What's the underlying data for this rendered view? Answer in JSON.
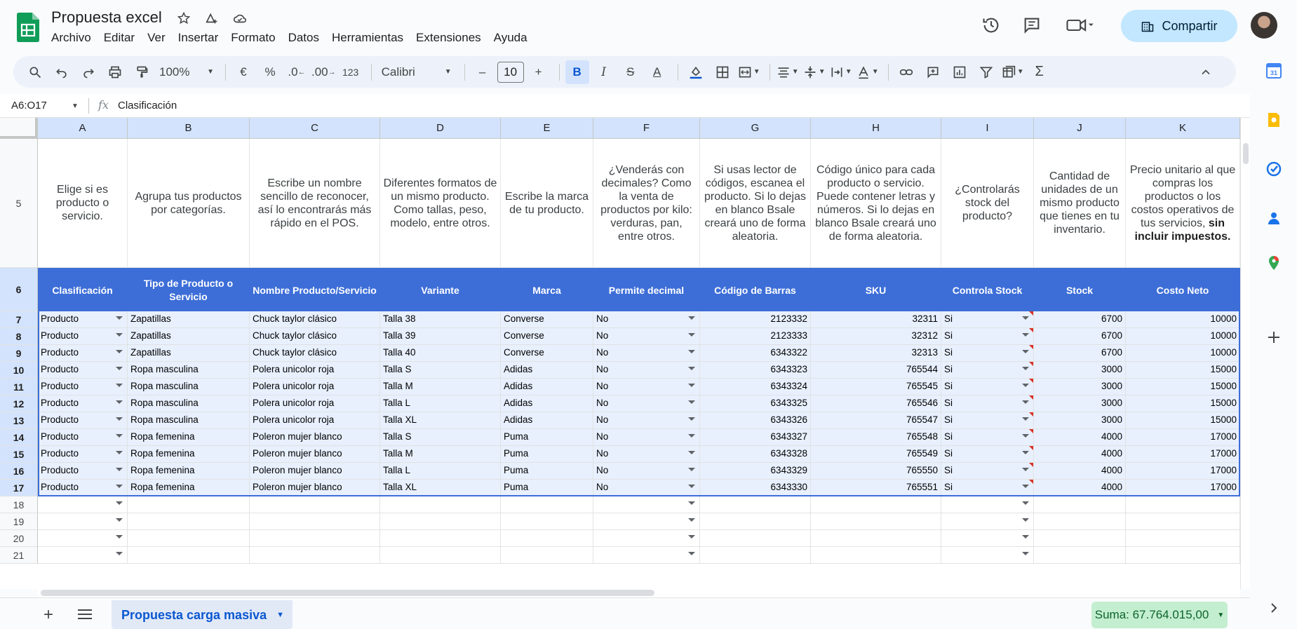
{
  "doc": {
    "title": "Propuesta excel"
  },
  "menu": [
    "Archivo",
    "Editar",
    "Ver",
    "Insertar",
    "Formato",
    "Datos",
    "Herramientas",
    "Extensiones",
    "Ayuda"
  ],
  "header": {
    "share_label": "Compartir"
  },
  "toolbar": {
    "zoom": "100%",
    "currency": "€",
    "percent": "%",
    "dec_less": ".0",
    "dec_more": ".00",
    "format_num": "123",
    "font": "Calibri",
    "font_size": "10",
    "minus": "–",
    "plus": "+",
    "bold": "B",
    "italic": "I",
    "strike": "S",
    "text_color": "A",
    "sum": "Σ"
  },
  "formula_bar": {
    "name_box": "A6:O17",
    "fx": "fx",
    "content": "Clasificación"
  },
  "columns": [
    "A",
    "B",
    "C",
    "D",
    "E",
    "F",
    "G",
    "H",
    "I",
    "J",
    "K"
  ],
  "descriptions": [
    "Elige si es producto o servicio.",
    "Agrupa tus productos por categorías.",
    "Escribe un nombre sencillo de reconocer, así lo encontrarás más rápido en el POS.",
    "Diferentes formatos de un mismo producto. Como tallas, peso, modelo, entre otros.",
    "Escribe la marca de tu producto.",
    "¿Venderás con decimales? Como la venta de productos por kilo: verduras, pan, entre otros.",
    "Si usas lector de códigos, escanea el producto. Si lo dejas en blanco Bsale creará uno de forma aleatoria.",
    "Código único para cada producto o servicio. Puede contener letras y números. Si lo dejas en blanco Bsale creará uno de forma aleatoria.",
    "¿Controlarás stock del producto?",
    "Cantidad de unidades de un mismo producto que tienes en tu inventario.",
    "Precio unitario al que compras los productos o los costos operativos de tus servicios,"
  ],
  "desc_k_bold": "sin incluir impuestos.",
  "headers": [
    "Clasificación",
    "Tipo de Producto o Servicio",
    "Nombre Producto/Servicio",
    "Variante",
    "Marca",
    "Permite decimal",
    "Código de Barras",
    "SKU",
    "Controla Stock",
    "Stock",
    "Costo Neto"
  ],
  "row_numbers": [
    "5",
    "6",
    "7",
    "8",
    "9",
    "10",
    "11",
    "12",
    "13",
    "14",
    "15",
    "16",
    "17",
    "18",
    "19",
    "20",
    "21"
  ],
  "rows": [
    [
      "Producto",
      "Zapatillas",
      "Chuck taylor clásico",
      "Talla 38",
      "Converse",
      "No",
      "2123332",
      "32311",
      "Si",
      "6700",
      "10000"
    ],
    [
      "Producto",
      "Zapatillas",
      "Chuck taylor clásico",
      "Talla 39",
      "Converse",
      "No",
      "2123333",
      "32312",
      "Si",
      "6700",
      "10000"
    ],
    [
      "Producto",
      "Zapatillas",
      "Chuck taylor clásico",
      "Talla 40",
      "Converse",
      "No",
      "6343322",
      "32313",
      "Si",
      "6700",
      "10000"
    ],
    [
      "Producto",
      "Ropa masculina",
      "Polera unicolor roja",
      "Talla S",
      "Adidas",
      "No",
      "6343323",
      "765544",
      "Si",
      "3000",
      "15000"
    ],
    [
      "Producto",
      "Ropa masculina",
      "Polera unicolor roja",
      "Talla M",
      "Adidas",
      "No",
      "6343324",
      "765545",
      "Si",
      "3000",
      "15000"
    ],
    [
      "Producto",
      "Ropa masculina",
      "Polera unicolor roja",
      "Talla L",
      "Adidas",
      "No",
      "6343325",
      "765546",
      "Si",
      "3000",
      "15000"
    ],
    [
      "Producto",
      "Ropa masculina",
      "Polera unicolor roja",
      "Talla XL",
      "Adidas",
      "No",
      "6343326",
      "765547",
      "Si",
      "3000",
      "15000"
    ],
    [
      "Producto",
      "Ropa femenina",
      "Poleron mujer blanco",
      "Talla S",
      "Puma",
      "No",
      "6343327",
      "765548",
      "Si",
      "4000",
      "17000"
    ],
    [
      "Producto",
      "Ropa femenina",
      "Poleron mujer blanco",
      "Talla M",
      "Puma",
      "No",
      "6343328",
      "765549",
      "Si",
      "4000",
      "17000"
    ],
    [
      "Producto",
      "Ropa femenina",
      "Poleron mujer blanco",
      "Talla L",
      "Puma",
      "No",
      "6343329",
      "765550",
      "Si",
      "4000",
      "17000"
    ],
    [
      "Producto",
      "Ropa femenina",
      "Poleron mujer blanco",
      "Talla XL",
      "Puma",
      "No",
      "6343330",
      "765551",
      "Si",
      "4000",
      "17000"
    ]
  ],
  "sheet": {
    "tab_label": "Propuesta carga masiva",
    "sum_label": "Suma: 67.764.015,00"
  },
  "colors": {
    "header_blue": "#3d6ed8",
    "selection_fill": "#e8f0fe",
    "share_bg": "#c2e7ff",
    "sum_bg": "#c4eed0"
  }
}
